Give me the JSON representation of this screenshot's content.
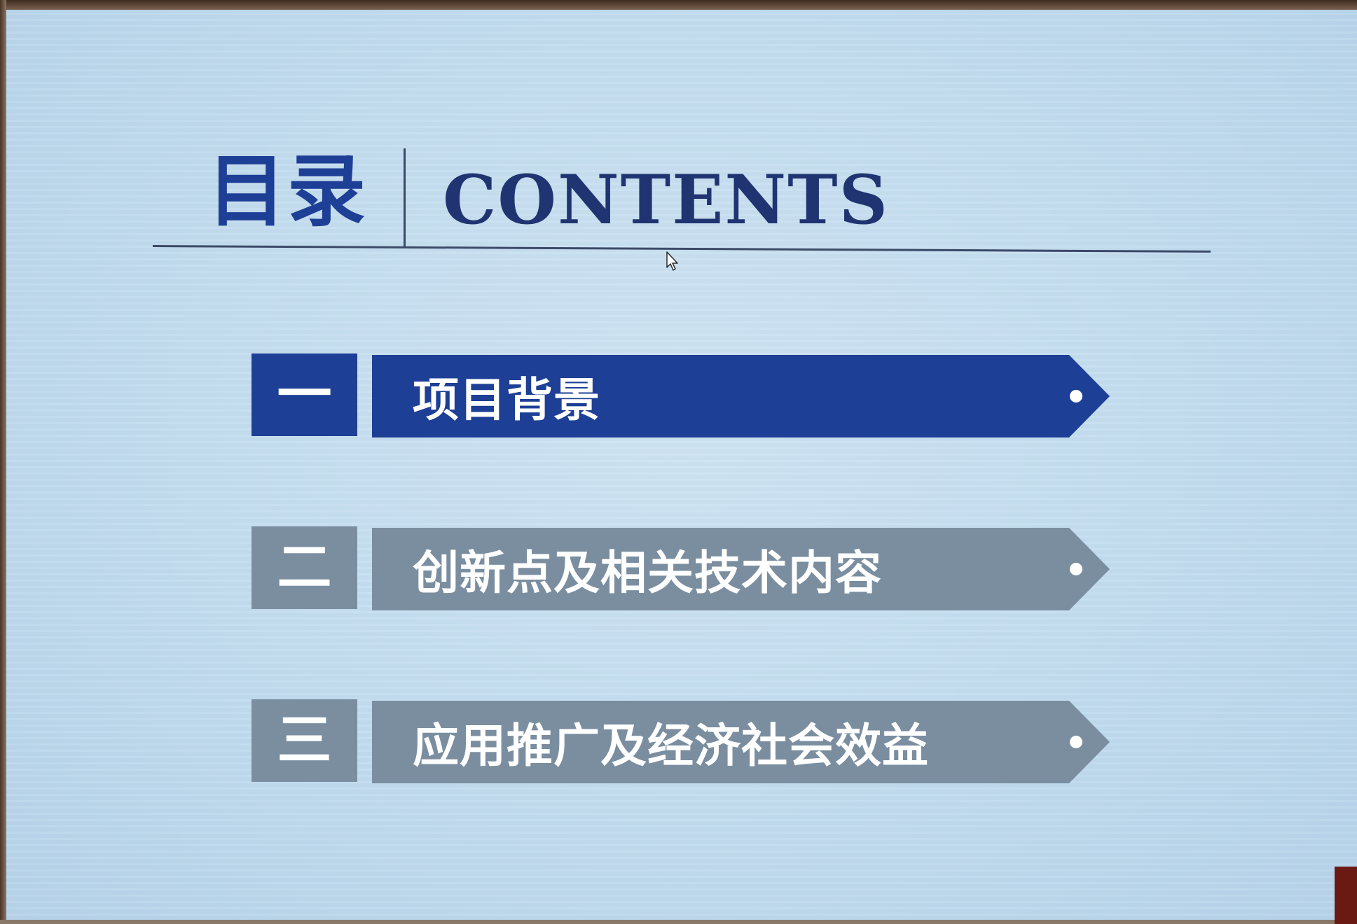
{
  "slide": {
    "title_cn": "目录",
    "title_en": "CONTENTS",
    "colors": {
      "active": "#1d3f95",
      "inactive": "#7a8ea0",
      "title": "#1e3f96",
      "background": "#c2dcef"
    },
    "items": [
      {
        "number": "一",
        "label": "项目背景",
        "state": "active"
      },
      {
        "number": "二",
        "label": "创新点及相关技术内容",
        "state": "inactive"
      },
      {
        "number": "三",
        "label": "应用推广及经济社会效益",
        "state": "inactive"
      }
    ]
  }
}
